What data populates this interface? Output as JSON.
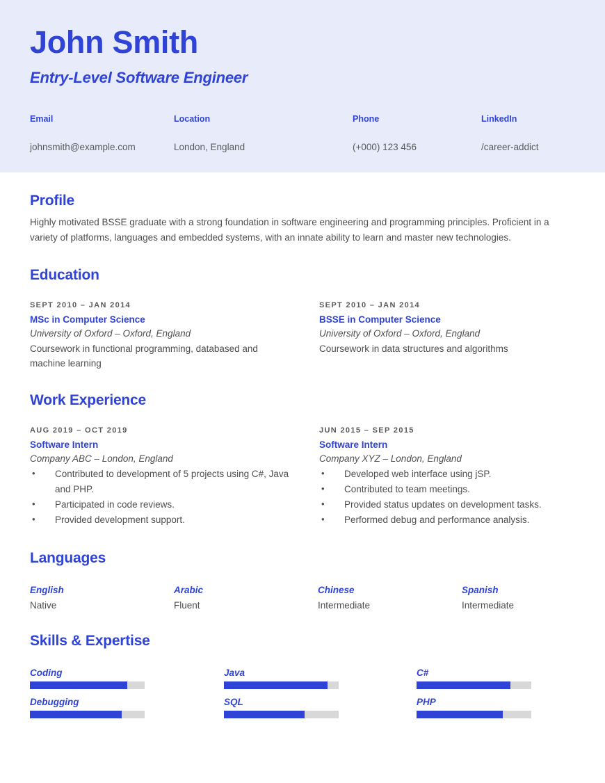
{
  "header": {
    "name": "John Smith",
    "job_title": "Entry-Level Software Engineer",
    "accent_color": "#2f43d6",
    "band_color": "#e8ebfa",
    "contacts": [
      {
        "label": "Email",
        "value": "johnsmith@example.com"
      },
      {
        "label": "Location",
        "value": "London, England"
      },
      {
        "label": "Phone",
        "value": "(+000) 123 456"
      },
      {
        "label": "LinkedIn",
        "value": "/career-addict"
      }
    ]
  },
  "profile": {
    "title": "Profile",
    "text": "Highly motivated BSSE graduate with a strong foundation in software engineering and programming principles. Proficient in a variety of platforms, languages and embedded systems, with an innate ability to learn and master new technologies."
  },
  "education": {
    "title": "Education",
    "entries": [
      {
        "date": "SEPT 2010 – JAN 2014",
        "degree": "MSc in Computer Science",
        "school": "University of Oxford – Oxford, England",
        "description": "Coursework in functional programming, databased and machine learning"
      },
      {
        "date": "SEPT 2010 – JAN 2014",
        "degree": "BSSE in Computer Science",
        "school": "University of Oxford – Oxford, England",
        "description": "Coursework in data structures and algorithms"
      }
    ]
  },
  "work": {
    "title": "Work Experience",
    "entries": [
      {
        "date": "AUG 2019 – OCT 2019",
        "role": "Software Intern",
        "company": "Company ABC – London, England",
        "bullets": [
          "Contributed to development of 5 projects using C#, Java and PHP.",
          "Participated in code reviews.",
          "Provided development support."
        ]
      },
      {
        "date": "JUN 2015 – SEP 2015",
        "role": "Software Intern",
        "company": "Company XYZ – London, England",
        "bullets": [
          "Developed web interface using jSP.",
          "Contributed to team meetings.",
          "Provided status updates on development tasks.",
          "Performed debug and performance analysis."
        ]
      }
    ]
  },
  "languages": {
    "title": "Languages",
    "items": [
      {
        "name": "English",
        "level": "Native"
      },
      {
        "name": "Arabic",
        "level": "Fluent"
      },
      {
        "name": "Chinese",
        "level": "Intermediate"
      },
      {
        "name": "Spanish",
        "level": "Intermediate"
      }
    ]
  },
  "skills": {
    "title": "Skills & Expertise",
    "columns": [
      [
        {
          "name": "Coding",
          "percent": 85
        },
        {
          "name": "Debugging",
          "percent": 80
        }
      ],
      [
        {
          "name": "Java",
          "percent": 90
        },
        {
          "name": "SQL",
          "percent": 70
        }
      ],
      [
        {
          "name": "C#",
          "percent": 82
        },
        {
          "name": "PHP",
          "percent": 75
        }
      ]
    ]
  }
}
